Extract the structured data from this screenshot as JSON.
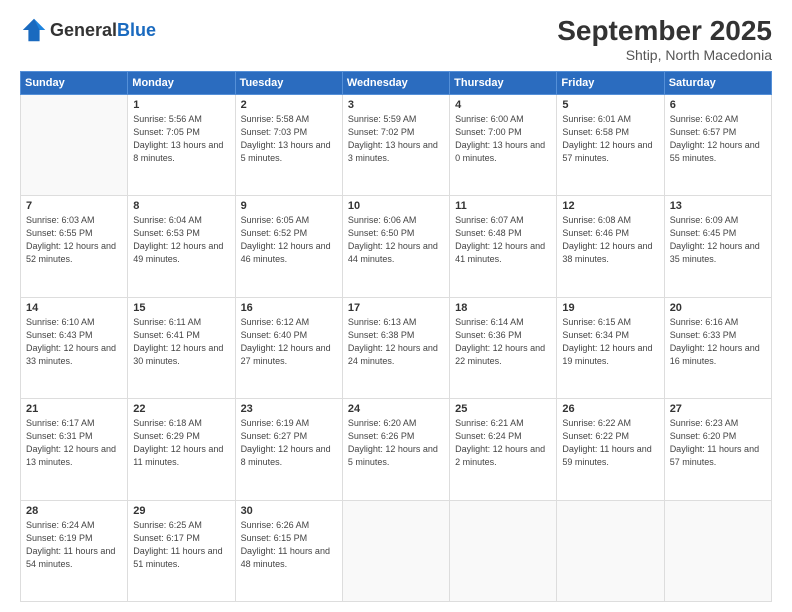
{
  "logo": {
    "general": "General",
    "blue": "Blue"
  },
  "header": {
    "month": "September 2025",
    "location": "Shtip, North Macedonia"
  },
  "weekdays": [
    "Sunday",
    "Monday",
    "Tuesday",
    "Wednesday",
    "Thursday",
    "Friday",
    "Saturday"
  ],
  "weeks": [
    [
      {
        "day": "",
        "sunrise": "",
        "sunset": "",
        "daylight": ""
      },
      {
        "day": "1",
        "sunrise": "Sunrise: 5:56 AM",
        "sunset": "Sunset: 7:05 PM",
        "daylight": "Daylight: 13 hours and 8 minutes."
      },
      {
        "day": "2",
        "sunrise": "Sunrise: 5:58 AM",
        "sunset": "Sunset: 7:03 PM",
        "daylight": "Daylight: 13 hours and 5 minutes."
      },
      {
        "day": "3",
        "sunrise": "Sunrise: 5:59 AM",
        "sunset": "Sunset: 7:02 PM",
        "daylight": "Daylight: 13 hours and 3 minutes."
      },
      {
        "day": "4",
        "sunrise": "Sunrise: 6:00 AM",
        "sunset": "Sunset: 7:00 PM",
        "daylight": "Daylight: 13 hours and 0 minutes."
      },
      {
        "day": "5",
        "sunrise": "Sunrise: 6:01 AM",
        "sunset": "Sunset: 6:58 PM",
        "daylight": "Daylight: 12 hours and 57 minutes."
      },
      {
        "day": "6",
        "sunrise": "Sunrise: 6:02 AM",
        "sunset": "Sunset: 6:57 PM",
        "daylight": "Daylight: 12 hours and 55 minutes."
      }
    ],
    [
      {
        "day": "7",
        "sunrise": "Sunrise: 6:03 AM",
        "sunset": "Sunset: 6:55 PM",
        "daylight": "Daylight: 12 hours and 52 minutes."
      },
      {
        "day": "8",
        "sunrise": "Sunrise: 6:04 AM",
        "sunset": "Sunset: 6:53 PM",
        "daylight": "Daylight: 12 hours and 49 minutes."
      },
      {
        "day": "9",
        "sunrise": "Sunrise: 6:05 AM",
        "sunset": "Sunset: 6:52 PM",
        "daylight": "Daylight: 12 hours and 46 minutes."
      },
      {
        "day": "10",
        "sunrise": "Sunrise: 6:06 AM",
        "sunset": "Sunset: 6:50 PM",
        "daylight": "Daylight: 12 hours and 44 minutes."
      },
      {
        "day": "11",
        "sunrise": "Sunrise: 6:07 AM",
        "sunset": "Sunset: 6:48 PM",
        "daylight": "Daylight: 12 hours and 41 minutes."
      },
      {
        "day": "12",
        "sunrise": "Sunrise: 6:08 AM",
        "sunset": "Sunset: 6:46 PM",
        "daylight": "Daylight: 12 hours and 38 minutes."
      },
      {
        "day": "13",
        "sunrise": "Sunrise: 6:09 AM",
        "sunset": "Sunset: 6:45 PM",
        "daylight": "Daylight: 12 hours and 35 minutes."
      }
    ],
    [
      {
        "day": "14",
        "sunrise": "Sunrise: 6:10 AM",
        "sunset": "Sunset: 6:43 PM",
        "daylight": "Daylight: 12 hours and 33 minutes."
      },
      {
        "day": "15",
        "sunrise": "Sunrise: 6:11 AM",
        "sunset": "Sunset: 6:41 PM",
        "daylight": "Daylight: 12 hours and 30 minutes."
      },
      {
        "day": "16",
        "sunrise": "Sunrise: 6:12 AM",
        "sunset": "Sunset: 6:40 PM",
        "daylight": "Daylight: 12 hours and 27 minutes."
      },
      {
        "day": "17",
        "sunrise": "Sunrise: 6:13 AM",
        "sunset": "Sunset: 6:38 PM",
        "daylight": "Daylight: 12 hours and 24 minutes."
      },
      {
        "day": "18",
        "sunrise": "Sunrise: 6:14 AM",
        "sunset": "Sunset: 6:36 PM",
        "daylight": "Daylight: 12 hours and 22 minutes."
      },
      {
        "day": "19",
        "sunrise": "Sunrise: 6:15 AM",
        "sunset": "Sunset: 6:34 PM",
        "daylight": "Daylight: 12 hours and 19 minutes."
      },
      {
        "day": "20",
        "sunrise": "Sunrise: 6:16 AM",
        "sunset": "Sunset: 6:33 PM",
        "daylight": "Daylight: 12 hours and 16 minutes."
      }
    ],
    [
      {
        "day": "21",
        "sunrise": "Sunrise: 6:17 AM",
        "sunset": "Sunset: 6:31 PM",
        "daylight": "Daylight: 12 hours and 13 minutes."
      },
      {
        "day": "22",
        "sunrise": "Sunrise: 6:18 AM",
        "sunset": "Sunset: 6:29 PM",
        "daylight": "Daylight: 12 hours and 11 minutes."
      },
      {
        "day": "23",
        "sunrise": "Sunrise: 6:19 AM",
        "sunset": "Sunset: 6:27 PM",
        "daylight": "Daylight: 12 hours and 8 minutes."
      },
      {
        "day": "24",
        "sunrise": "Sunrise: 6:20 AM",
        "sunset": "Sunset: 6:26 PM",
        "daylight": "Daylight: 12 hours and 5 minutes."
      },
      {
        "day": "25",
        "sunrise": "Sunrise: 6:21 AM",
        "sunset": "Sunset: 6:24 PM",
        "daylight": "Daylight: 12 hours and 2 minutes."
      },
      {
        "day": "26",
        "sunrise": "Sunrise: 6:22 AM",
        "sunset": "Sunset: 6:22 PM",
        "daylight": "Daylight: 11 hours and 59 minutes."
      },
      {
        "day": "27",
        "sunrise": "Sunrise: 6:23 AM",
        "sunset": "Sunset: 6:20 PM",
        "daylight": "Daylight: 11 hours and 57 minutes."
      }
    ],
    [
      {
        "day": "28",
        "sunrise": "Sunrise: 6:24 AM",
        "sunset": "Sunset: 6:19 PM",
        "daylight": "Daylight: 11 hours and 54 minutes."
      },
      {
        "day": "29",
        "sunrise": "Sunrise: 6:25 AM",
        "sunset": "Sunset: 6:17 PM",
        "daylight": "Daylight: 11 hours and 51 minutes."
      },
      {
        "day": "30",
        "sunrise": "Sunrise: 6:26 AM",
        "sunset": "Sunset: 6:15 PM",
        "daylight": "Daylight: 11 hours and 48 minutes."
      },
      {
        "day": "",
        "sunrise": "",
        "sunset": "",
        "daylight": ""
      },
      {
        "day": "",
        "sunrise": "",
        "sunset": "",
        "daylight": ""
      },
      {
        "day": "",
        "sunrise": "",
        "sunset": "",
        "daylight": ""
      },
      {
        "day": "",
        "sunrise": "",
        "sunset": "",
        "daylight": ""
      }
    ]
  ]
}
